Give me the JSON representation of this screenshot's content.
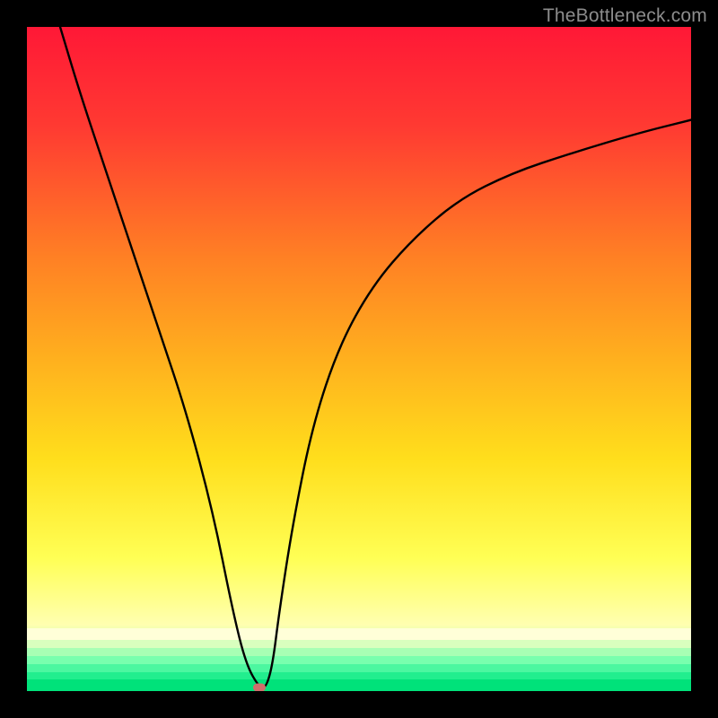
{
  "watermark": "TheBottleneck.com",
  "chart_data": {
    "type": "line",
    "title": "",
    "xlabel": "",
    "ylabel": "",
    "xlim": [
      0,
      100
    ],
    "ylim": [
      0,
      100
    ],
    "legend": "none",
    "grid": false,
    "axis_ticks": "none",
    "background": {
      "type": "vertical-gradient",
      "stops": [
        {
          "pos": 0,
          "color": "#ff1836"
        },
        {
          "pos": 15,
          "color": "#ff3a32"
        },
        {
          "pos": 35,
          "color": "#ff8124"
        },
        {
          "pos": 50,
          "color": "#ffb01e"
        },
        {
          "pos": 65,
          "color": "#ffde1c"
        },
        {
          "pos": 80,
          "color": "#ffff55"
        },
        {
          "pos": 90,
          "color": "#ffffb0"
        },
        {
          "pos": 95,
          "color": "#9cffb0"
        },
        {
          "pos": 100,
          "color": "#00e27a"
        }
      ]
    },
    "series": [
      {
        "name": "bottleneck-curve",
        "color": "#000000",
        "x": [
          5,
          8,
          12,
          16,
          20,
          24,
          28,
          31,
          33,
          35,
          36,
          37,
          38,
          40,
          43,
          47,
          52,
          58,
          65,
          73,
          82,
          92,
          100
        ],
        "y": [
          100,
          90,
          78,
          66,
          54,
          42,
          27,
          12,
          4,
          0.5,
          0.5,
          4,
          12,
          25,
          40,
          52,
          61,
          68,
          74,
          78,
          81,
          84,
          86
        ]
      }
    ],
    "marker": {
      "name": "optimal-point",
      "x": 35,
      "y": 0.5,
      "color": "#cf6e6b"
    }
  }
}
